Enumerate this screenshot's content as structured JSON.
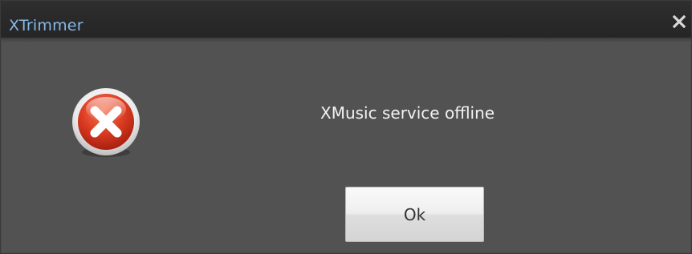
{
  "window": {
    "title": "XTrimmer",
    "close_icon": "close-icon"
  },
  "dialog": {
    "icon": "error-icon",
    "message": "XMusic service offline",
    "ok_label": "Ok"
  },
  "colors": {
    "title_text": "#86b8e6",
    "body_background": "#525252",
    "titlebar_background": "#2a2a2a",
    "message_text": "#f2f2f2",
    "error_red": "#d63a22"
  }
}
